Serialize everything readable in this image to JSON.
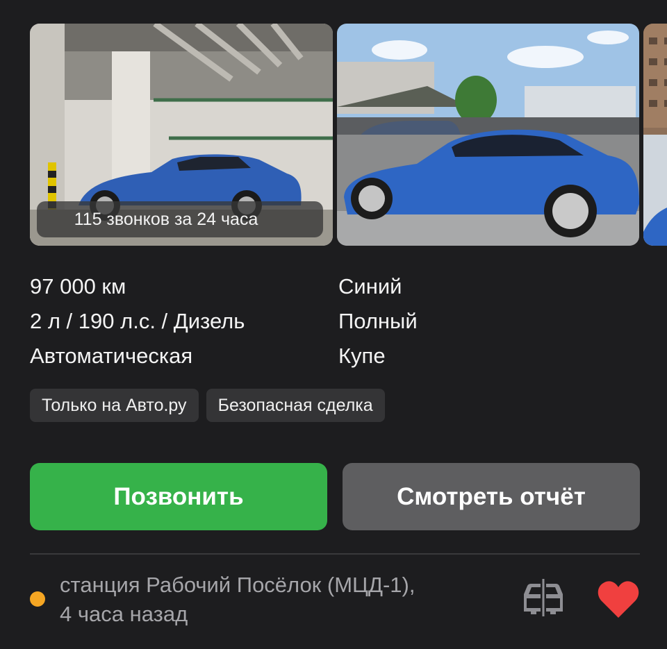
{
  "gallery": {
    "calls_badge": "115 звонков за 24 часа"
  },
  "specs": {
    "mileage": "97 000 км",
    "engine": "2 л / 190 л.с. / Дизель",
    "transmission": "Автоматическая",
    "color": "Синий",
    "drive": "Полный",
    "body": "Купе"
  },
  "tags": [
    "Только на Авто.ру",
    "Безопасная сделка"
  ],
  "actions": {
    "call_label": "Позвонить",
    "report_label": "Смотреть отчёт"
  },
  "footer": {
    "location_line1": "станция Рабочий Посёлок (МЦД-1),",
    "location_line2": "4 часа назад",
    "status_color": "#f5a623",
    "compare_icon": "compare-cars-icon",
    "favorite_icon": "heart-icon",
    "favorite_color": "#f0403f"
  },
  "colors": {
    "background": "#1d1d1f",
    "call_button": "#36b24a",
    "report_button": "#5e5e60",
    "tag_background": "#343436"
  }
}
